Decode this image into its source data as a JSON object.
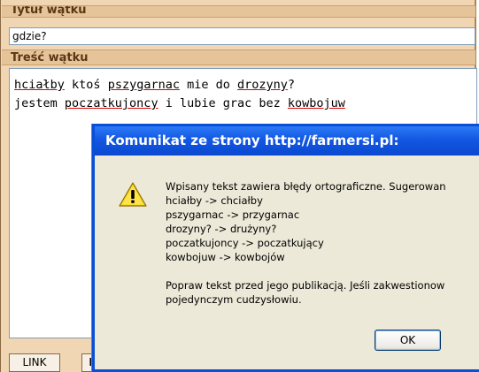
{
  "form": {
    "title_header": "Tytuł wątku",
    "title_value": "gdzie?",
    "content_header": "Treść wątku",
    "content_lines": [
      {
        "parts": [
          {
            "t": "hciałby",
            "err": true
          },
          {
            "t": " ",
            "err": false
          },
          {
            "t": "ktoś",
            "err": false
          },
          {
            "t": " ",
            "err": false
          },
          {
            "t": "pszygarnac",
            "err": true
          },
          {
            "t": " mie do ",
            "err": false
          },
          {
            "t": "drozyny",
            "err": true
          },
          {
            "t": "?",
            "err": false
          }
        ]
      },
      {
        "parts": [
          {
            "t": "jestem ",
            "err": false
          },
          {
            "t": "poczatkujoncy",
            "err": true
          },
          {
            "t": " i lubie grac bez ",
            "err": false
          },
          {
            "t": "kowbojuw",
            "err": true
          }
        ]
      }
    ],
    "toolbar": {
      "link_label": "LINK",
      "bold_label": "B"
    }
  },
  "dialog": {
    "title": "Komunikat ze strony http://farmersi.pl:",
    "icon": "warning-icon",
    "lines": [
      "Wpisany tekst zawiera błędy ortograficzne. Sugerowan",
      "hciałby -> chciałby",
      "pszygarnac -> przygarnac",
      "drozyny? -> drużyny?",
      "poczatkujoncy -> poczatkujący",
      "kowbojuw -> kowbojów",
      "",
      "Popraw tekst przed jego publikacją. Jeśli zakwestionow",
      "pojedynczym cudzysłowiu."
    ],
    "ok_label": "OK"
  },
  "colors": {
    "panel_bg": "#f0d6b2",
    "header_text": "#5a3712",
    "dialog_title_bg": "#0a49d0",
    "dialog_bg": "#ece9d8"
  }
}
